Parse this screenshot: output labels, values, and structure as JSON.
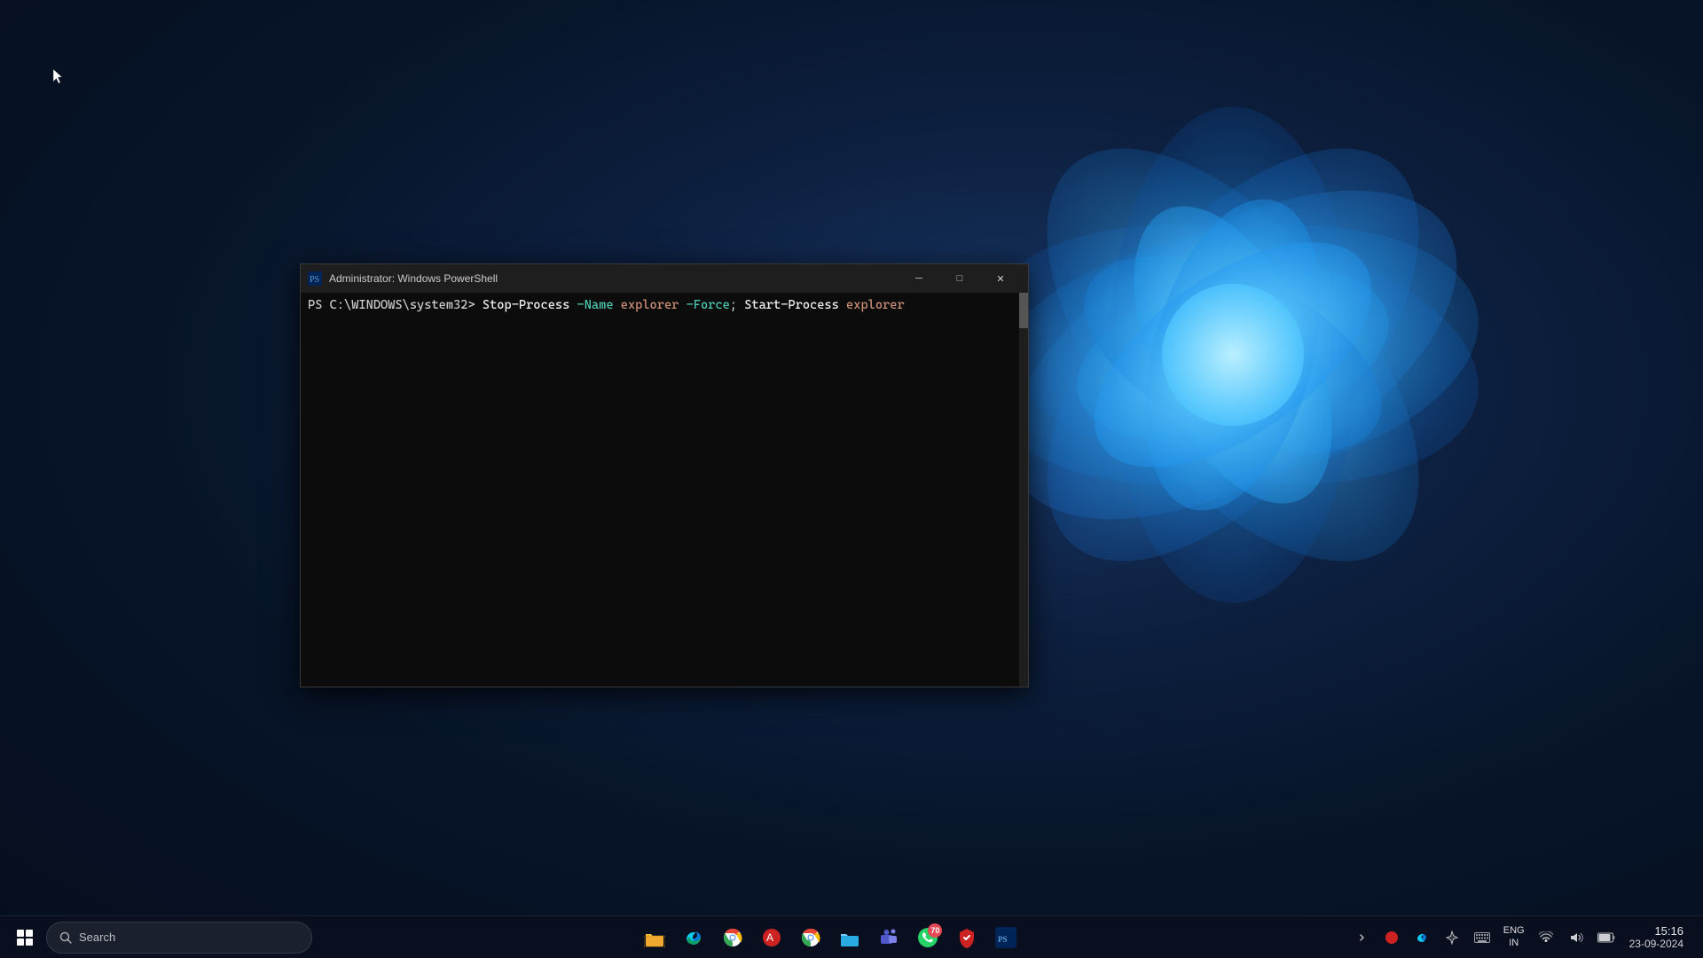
{
  "desktop": {
    "background": "#0a1628"
  },
  "powershell": {
    "title": "Administrator: Windows PowerShell",
    "prompt": "PS C:\\WINDOWS\\system32> ",
    "command": "Stop-Process",
    "param1": "-Name",
    "value1": "explorer",
    "param2": "-Force",
    "separator": ";",
    "command2": "Start-Process",
    "value2": "explorer",
    "minimize_label": "─",
    "maximize_label": "□",
    "close_label": "✕"
  },
  "taskbar": {
    "search_text": "Search",
    "search_placeholder": "Search",
    "clock_time": "15:16",
    "clock_date": "23-09-2024",
    "lang_line1": "ENG",
    "lang_line2": "IN",
    "whatsapp_badge": "70",
    "icons": [
      {
        "name": "file-explorer",
        "label": "File Explorer"
      },
      {
        "name": "edge-chromium",
        "label": "Microsoft Edge (Chromium)"
      },
      {
        "name": "chrome",
        "label": "Google Chrome"
      },
      {
        "name": "red-app",
        "label": "Application"
      },
      {
        "name": "chrome-alt",
        "label": "Chrome"
      },
      {
        "name": "files",
        "label": "Files"
      },
      {
        "name": "teams",
        "label": "Microsoft Teams"
      },
      {
        "name": "whatsapp",
        "label": "WhatsApp"
      },
      {
        "name": "security",
        "label": "Security App"
      },
      {
        "name": "powershell",
        "label": "Windows PowerShell"
      }
    ]
  }
}
